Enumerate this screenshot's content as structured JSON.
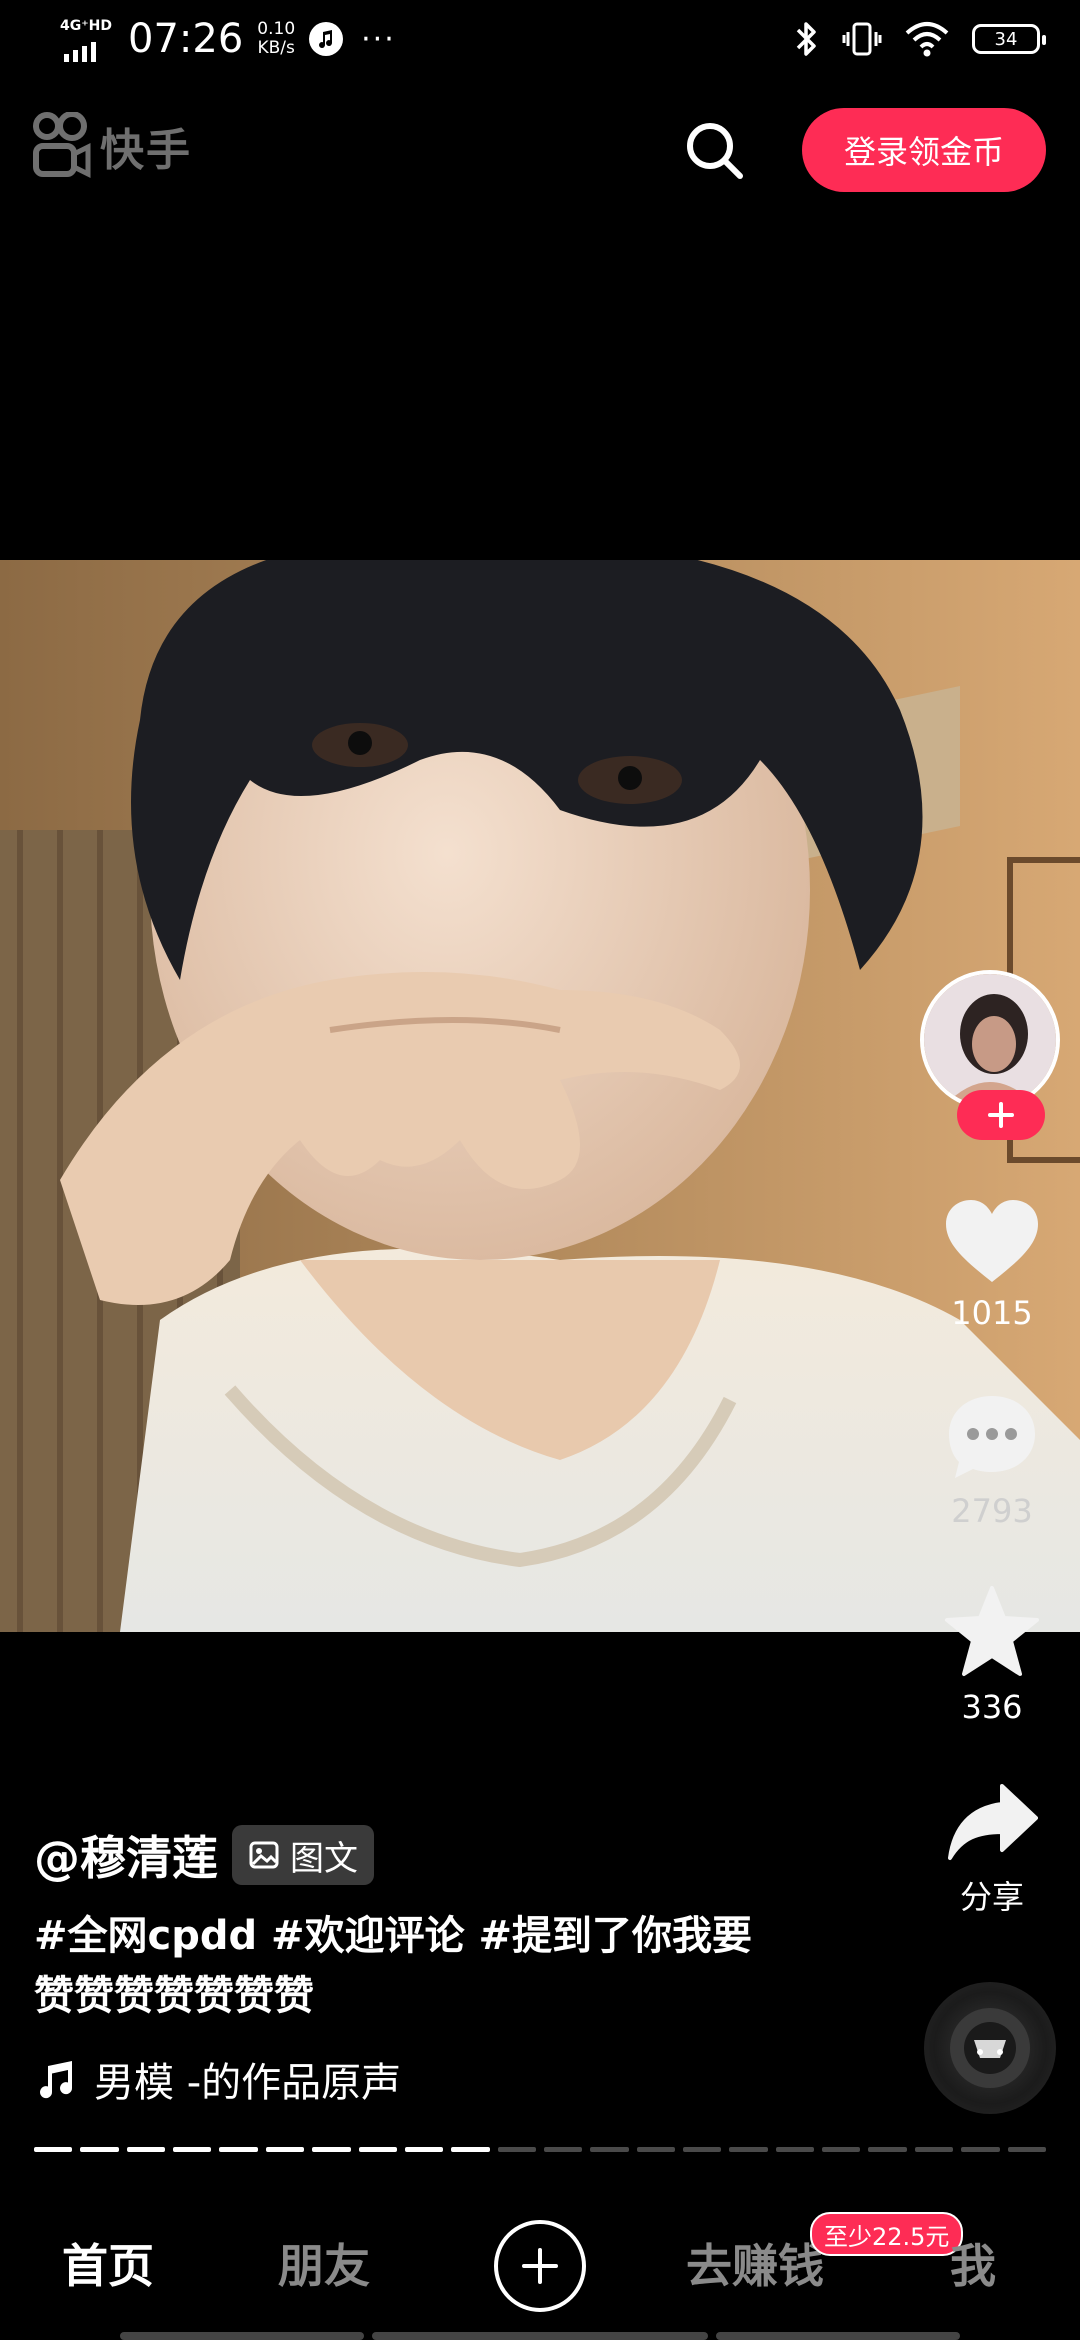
{
  "status_bar": {
    "network": "4G⁺HD",
    "time": "07:26",
    "speed_value": "0.10",
    "speed_unit": "KB/s",
    "overflow": "···",
    "battery": "34"
  },
  "header": {
    "app_name": "快手",
    "login_button": "登录领金币",
    "search_icon": "search-icon"
  },
  "post": {
    "author": "@穆清莲",
    "type_chip": "图文",
    "description": "#全网cpdd #欢迎评论 #提到了你我要赞赞赞赞赞赞赞",
    "music": "男模 -的作品原声",
    "progress_total_segments": 22,
    "progress_viewed_segments": 10
  },
  "actions": {
    "likes": "1015",
    "comments": "2793",
    "favorites": "336",
    "share": "分享"
  },
  "bottom_nav": {
    "home": "首页",
    "friends": "朋友",
    "earn": "去赚钱",
    "earn_badge": "至少22.5元",
    "me": "我"
  },
  "colors": {
    "accent": "#fe2c55",
    "background": "#000000"
  }
}
